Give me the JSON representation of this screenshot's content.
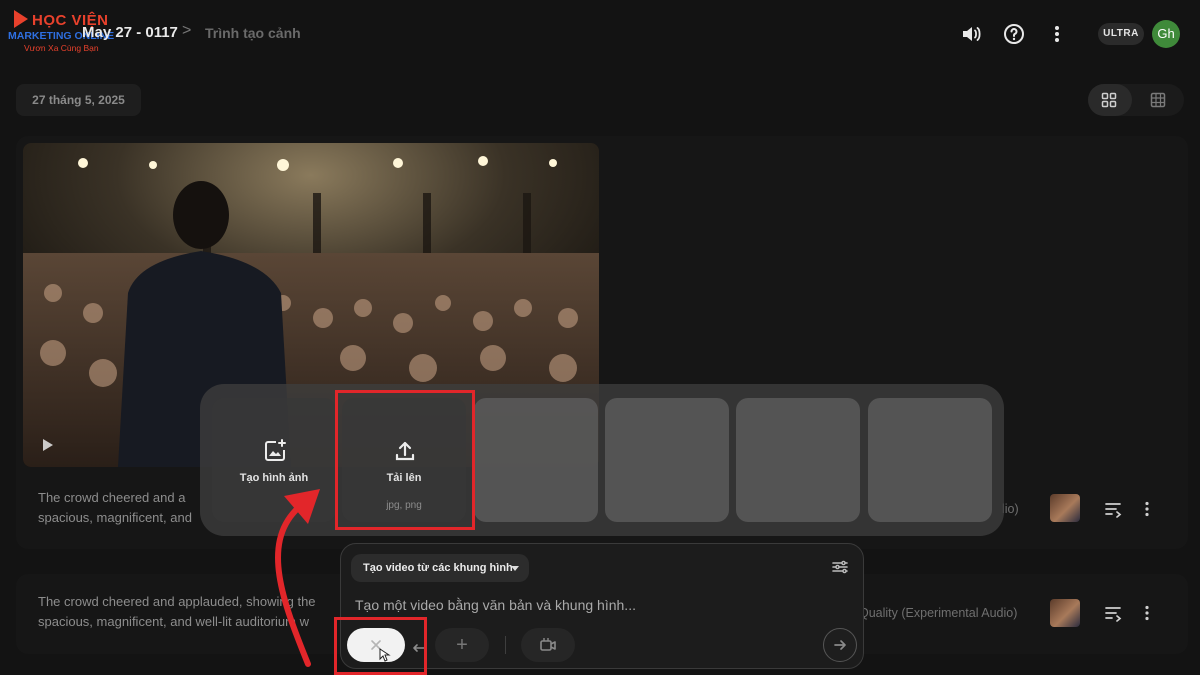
{
  "logo": {
    "line1": "HỌC VIỆN",
    "line2": "MARKETING ONLINE",
    "line3": "Vươn Xa Cùng Bạn"
  },
  "header": {
    "project_title": "May 27 - 0117",
    "separator": ">",
    "current_page": "Trình tạo cảnh",
    "plan_badge": "ULTRA",
    "avatar_initials": "Gh"
  },
  "date_chip": "27 tháng 5, 2025",
  "clips": [
    {
      "description": "The crowd cheered and applauded, showing the spacious, magnificent, and well-lit auditorium",
      "line1": "The crowd cheered and a",
      "line2": "spacious, magnificent, and",
      "model_label": "lio)"
    },
    {
      "line1": "The crowd cheered and applauded, showing the",
      "line2": "spacious, magnificent, and well-lit auditorium w",
      "model_label": "Quality (Experimental Audio)"
    }
  ],
  "frames_picker": {
    "create_image_label": "Tạo hình ảnh",
    "upload_label": "Tải lên",
    "upload_formats": "jpg, png"
  },
  "composer": {
    "mode": "Tạo video từ các khung hình",
    "placeholder": "Tạo một video bằng văn bản và khung hình...",
    "add_symbol": "+"
  },
  "colors": {
    "background": "#131313",
    "accent_annotation": "#e2262a",
    "avatar": "#3f8a3a"
  }
}
